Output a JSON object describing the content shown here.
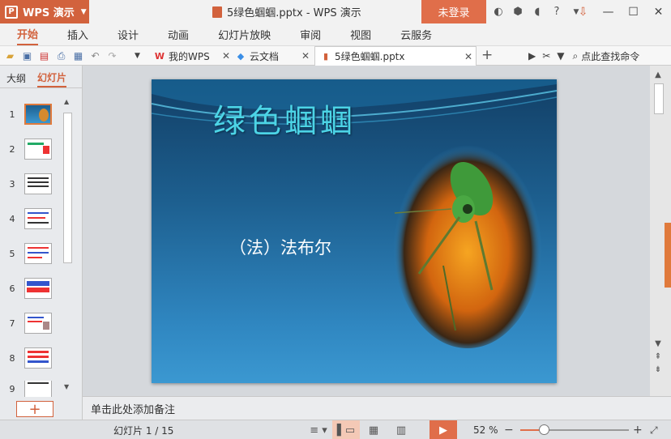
{
  "app": {
    "name": "WPS 演示",
    "logo_letter": "P",
    "window_title": "5绿色蝈蝈.pptx - WPS 演示",
    "login_label": "未登录"
  },
  "menu": [
    {
      "label": "开始",
      "active": true
    },
    {
      "label": "插入"
    },
    {
      "label": "设计"
    },
    {
      "label": "动画"
    },
    {
      "label": "幻灯片放映"
    },
    {
      "label": "审阅"
    },
    {
      "label": "视图"
    },
    {
      "label": "云服务"
    }
  ],
  "tabs": [
    {
      "label": "我的WPS",
      "icon": "wps-logo-icon"
    },
    {
      "label": "云文档",
      "icon": "cloud-box-icon"
    },
    {
      "label": "5绿色蝈蝈.pptx",
      "icon": "pptx-file-icon",
      "active": true
    }
  ],
  "search_command_label": "点此查找命令",
  "left_panel": {
    "tabs": [
      {
        "label": "大纲"
      },
      {
        "label": "幻灯片",
        "active": true
      }
    ],
    "thumbnails": [
      "1",
      "2",
      "3",
      "4",
      "5",
      "6",
      "7",
      "8",
      "9"
    ],
    "selected": 1
  },
  "slide": {
    "title": "绿色蝈蝈",
    "subtitle": "（法）法布尔"
  },
  "notes_placeholder": "单击此处添加备注",
  "status": {
    "slide_counter": "幻灯片 1 / 15",
    "zoom_label": "52 %",
    "zoom_fraction": 0.22
  },
  "colors": {
    "accent": "#d2623d",
    "login": "#e06e4a",
    "slide_title": "#4cd4e6"
  }
}
